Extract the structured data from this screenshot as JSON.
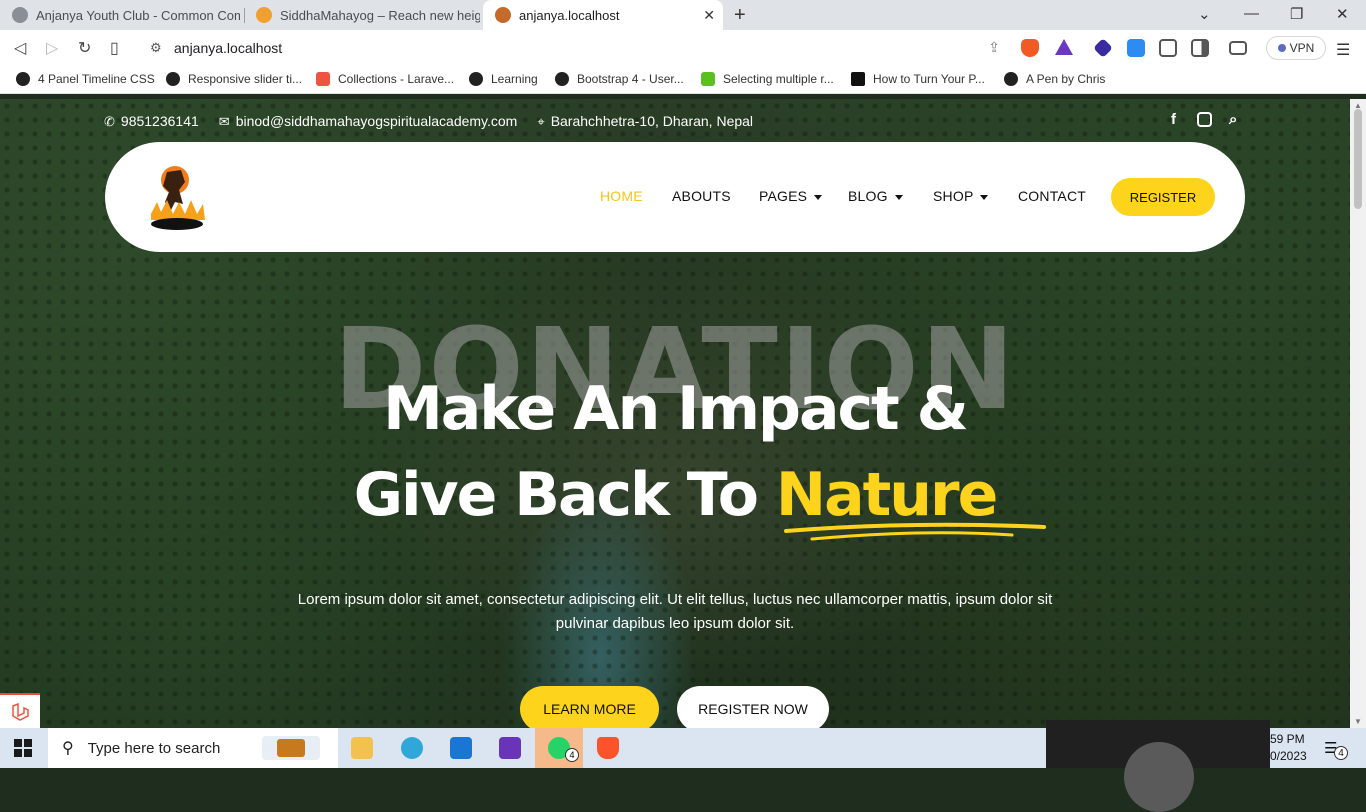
{
  "browser": {
    "tabs": [
      {
        "title": "Anjanya Youth Club - Common Comp",
        "active": false
      },
      {
        "title": "SiddhaMahayog – Reach new heights",
        "active": false
      },
      {
        "title": "anjanya.localhost",
        "active": true
      }
    ],
    "url": "anjanya.localhost",
    "vpn_label": "VPN",
    "bookmarks": [
      {
        "label": "4 Panel Timeline CSS",
        "icon": "codepen-icon"
      },
      {
        "label": "Responsive slider ti...",
        "icon": "codepen-icon"
      },
      {
        "label": "Collections - Larave...",
        "icon": "laravel-icon"
      },
      {
        "label": "Learning",
        "icon": "codepen-icon"
      },
      {
        "label": "Bootstrap 4 - User...",
        "icon": "codepen-icon"
      },
      {
        "label": "Selecting multiple r...",
        "icon": "green-icon"
      },
      {
        "label": "How to Turn Your P...",
        "icon": "black-square-icon"
      },
      {
        "label": "A Pen by Chris",
        "icon": "codepen-icon"
      }
    ]
  },
  "site": {
    "topbar": {
      "phone": "9851236141",
      "email": "binod@siddhamahayogspiritualacademy.com",
      "address": "Barahchhetra-10, Dharan, Nepal"
    },
    "nav": {
      "items": [
        {
          "label": "HOME",
          "active": true,
          "dropdown": false
        },
        {
          "label": "ABOUTS",
          "active": false,
          "dropdown": false
        },
        {
          "label": "PAGES",
          "active": false,
          "dropdown": true
        },
        {
          "label": "BLOG",
          "active": false,
          "dropdown": true
        },
        {
          "label": "SHOP",
          "active": false,
          "dropdown": true
        },
        {
          "label": "CONTACT",
          "active": false,
          "dropdown": false
        }
      ],
      "register_label": "REGISTER"
    },
    "hero": {
      "background_word": "DONATION",
      "line1": "Make An Impact &",
      "line2_prefix": "Give Back To ",
      "line2_highlight": "Nature",
      "description": "Lorem ipsum dolor sit amet, consectetur adipiscing elit. Ut elit tellus, luctus nec ullamcorper mattis, ipsum dolor sit pulvinar dapibus leo ipsum dolor sit.",
      "learn_more": "LEARN MORE",
      "register_now": "REGISTER NOW"
    },
    "colors": {
      "accent": "#fdd31b",
      "white": "#ffffff"
    }
  },
  "taskbar": {
    "search_placeholder": "Type here to search",
    "whatsapp_badge": "4",
    "clock_time": "59 PM",
    "clock_date": "0/2023",
    "notification_count": "4"
  }
}
